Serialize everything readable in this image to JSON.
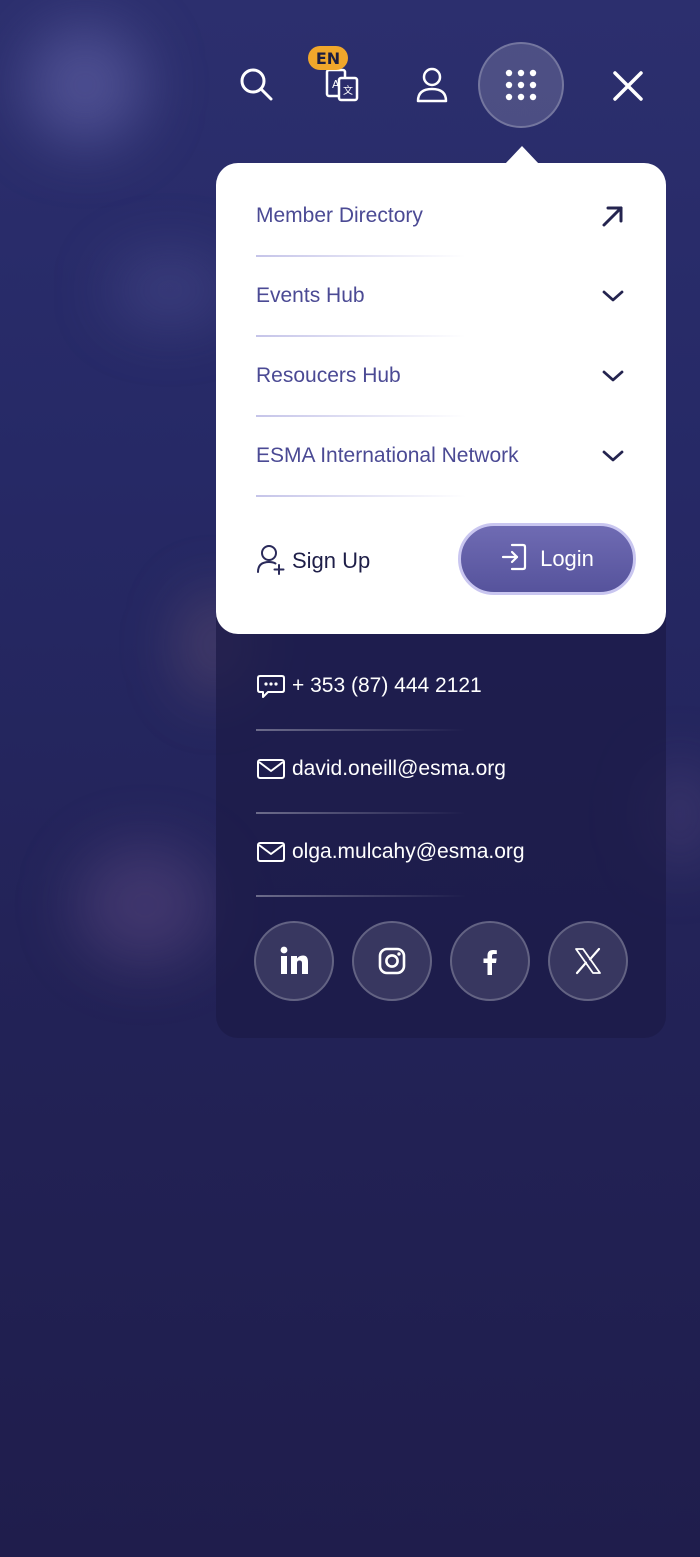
{
  "header": {
    "language_badge": "EN",
    "icons": [
      "search-icon",
      "translate-icon",
      "user-icon",
      "apps-grid-icon",
      "close-icon"
    ]
  },
  "menu": {
    "items": [
      {
        "label": "Member Directory",
        "icon": "arrow-up-right-icon"
      },
      {
        "label": "Events Hub",
        "icon": "chevron-down-icon"
      },
      {
        "label": "Resoucers Hub",
        "icon": "chevron-down-icon"
      },
      {
        "label": "ESMA International Network",
        "icon": "chevron-down-icon"
      }
    ],
    "signup_label": "Sign Up",
    "login_label": "Login"
  },
  "contact": {
    "phone": "+ 353 (87) 444 2121",
    "email_1": "david.oneill@esma.org",
    "email_2": "olga.mulcahy@esma.org"
  },
  "social": [
    "linkedin-icon",
    "instagram-icon",
    "facebook-icon",
    "x-icon"
  ],
  "colors": {
    "background": "#262966",
    "menu_text": "#4b4a94",
    "login_button": "#5f5ca6",
    "badge": "#f1a72b"
  }
}
